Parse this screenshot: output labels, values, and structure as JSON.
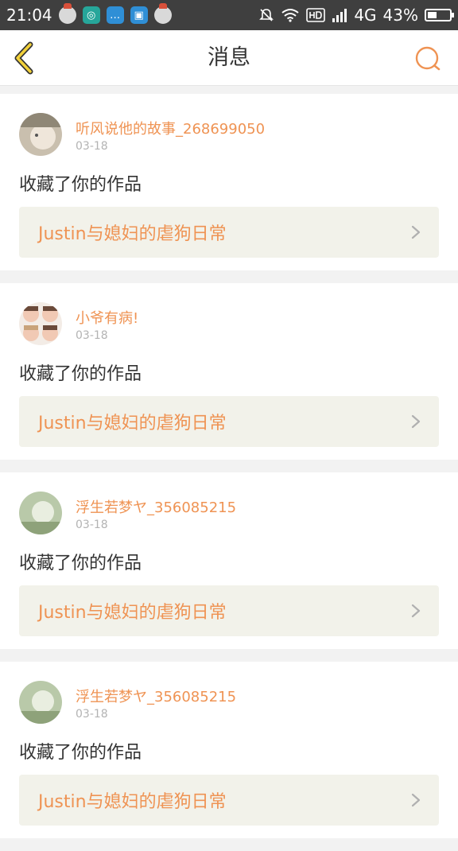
{
  "status_bar": {
    "time": "21:04",
    "network": "4G",
    "battery": "43%",
    "battery_level": 0.43
  },
  "header": {
    "title": "消息",
    "accent": "#ef9353",
    "back_icon": "chevron-left-icon",
    "search_icon": "search-icon"
  },
  "messages": [
    {
      "user": "听风说他的故事_268699050",
      "date": "03-18",
      "action": "收藏了你的作品",
      "work": "Justin与媳妇的虐狗日常"
    },
    {
      "user": "小爷有病!",
      "date": "03-18",
      "action": "收藏了你的作品",
      "work": "Justin与媳妇的虐狗日常"
    },
    {
      "user": "浮生若梦ヤ_356085215",
      "date": "03-18",
      "action": "收藏了你的作品",
      "work": "Justin与媳妇的虐狗日常"
    },
    {
      "user": "浮生若梦ヤ_356085215",
      "date": "03-18",
      "action": "收藏了你的作品",
      "work": "Justin与媳妇的虐狗日常"
    }
  ]
}
